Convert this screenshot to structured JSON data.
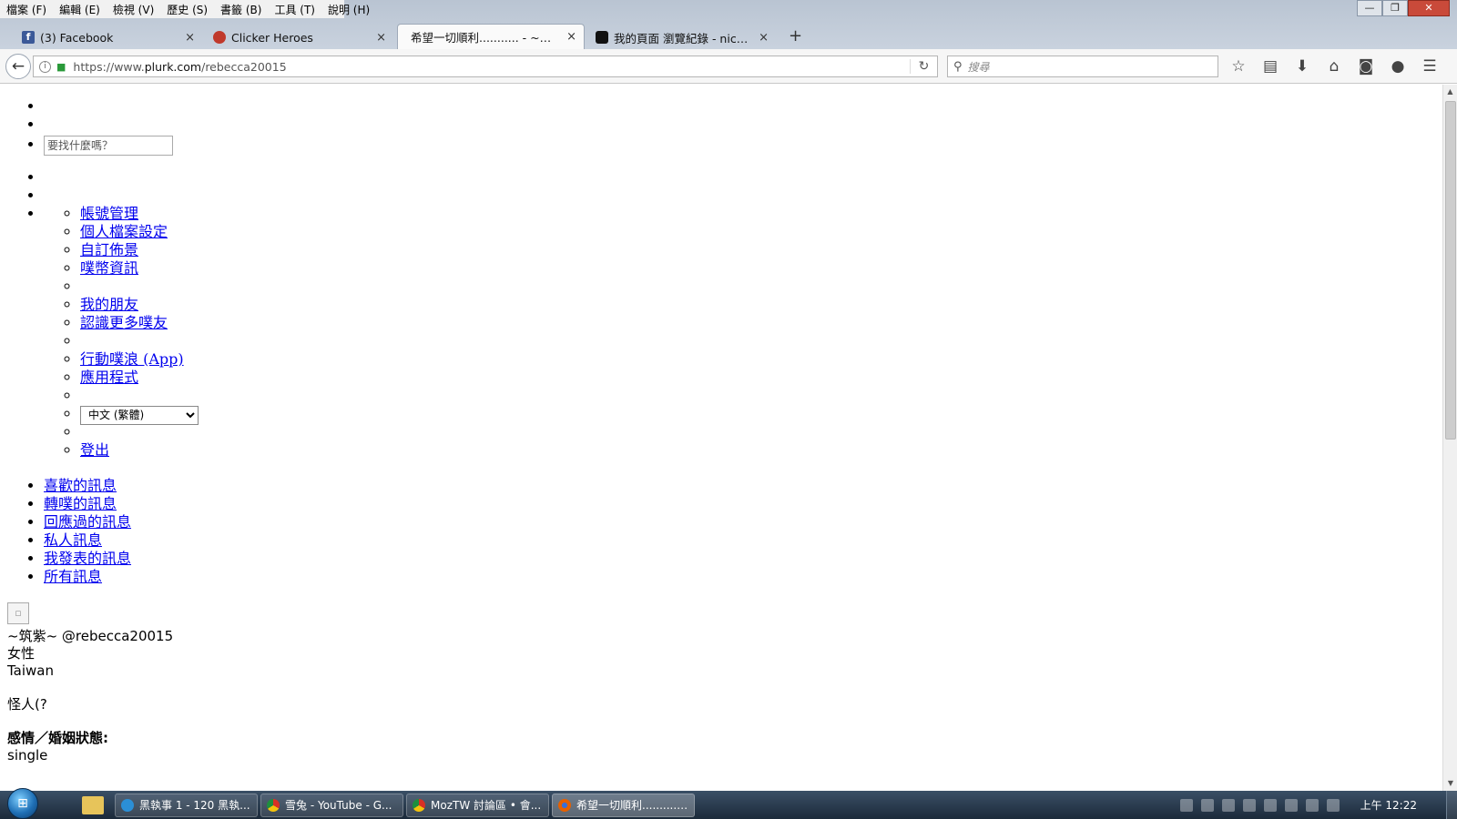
{
  "menubar": [
    "檔案 (F)",
    "編輯 (E)",
    "檢視 (V)",
    "歷史 (S)",
    "書籤 (B)",
    "工具 (T)",
    "說明 (H)"
  ],
  "window_controls": {
    "minimize": "—",
    "restore": "❐",
    "close": "✕"
  },
  "tabs": [
    {
      "title": "(3) Facebook",
      "favicon": "fb",
      "active": false
    },
    {
      "title": "Clicker Heroes",
      "favicon": "ch",
      "active": false
    },
    {
      "title": "希望一切順利........... - ~筑紫~ ...",
      "favicon": "none",
      "active": true
    },
    {
      "title": "我的頁面 瀏覽紀錄 - nicon...",
      "favicon": "nico",
      "active": false
    }
  ],
  "tab_close": "×",
  "new_tab": "+",
  "nav": {
    "url_prefix": "https://www.",
    "url_host": "plurk.com",
    "url_path": "/rebecca20015",
    "search_placeholder": "搜尋",
    "icons": [
      "bookmark-star-icon",
      "reading-list-icon",
      "download-icon",
      "home-icon",
      "pocket-icon",
      "chat-icon",
      "hamburger-menu-icon"
    ]
  },
  "page": {
    "search_placeholder": "要找什麼嗎？",
    "account_menu": [
      {
        "label": "帳號管理"
      },
      {
        "label": "個人檔案設定"
      },
      {
        "label": "自訂佈景"
      },
      {
        "label": "噗幣資訊"
      },
      {
        "label": ""
      },
      {
        "label": "我的朋友"
      },
      {
        "label": "認識更多噗友"
      },
      {
        "label": ""
      },
      {
        "label": "行動噗浪 (App)"
      },
      {
        "label": "應用程式"
      },
      {
        "label": ""
      },
      {
        "label": "__select__"
      },
      {
        "label": ""
      },
      {
        "label": "登出"
      }
    ],
    "language_selected": "中文 (繁體)",
    "filters": [
      "喜歡的訊息",
      "轉噗的訊息",
      "回應過的訊息",
      "私人訊息",
      "我發表的訊息",
      "所有訊息"
    ],
    "profile": {
      "display_name": "~筑紫~",
      "username": "@rebecca20015",
      "gender": "女性",
      "location": "Taiwan",
      "about": "怪人(?",
      "relationship_label": "感情／婚姻狀態:",
      "relationship_value": "single"
    }
  },
  "taskbar": {
    "items": [
      {
        "title": "黑執事 1 - 120 黑執...",
        "icon": "ie",
        "active": false
      },
      {
        "title": "雪兔 - YouTube - G...",
        "icon": "chrome",
        "active": false
      },
      {
        "title": "MozTW 討論區 • 會...",
        "icon": "chrome",
        "active": false
      },
      {
        "title": "希望一切順利........... ...",
        "icon": "ff",
        "active": true
      }
    ],
    "clock": "上午 12:22"
  }
}
